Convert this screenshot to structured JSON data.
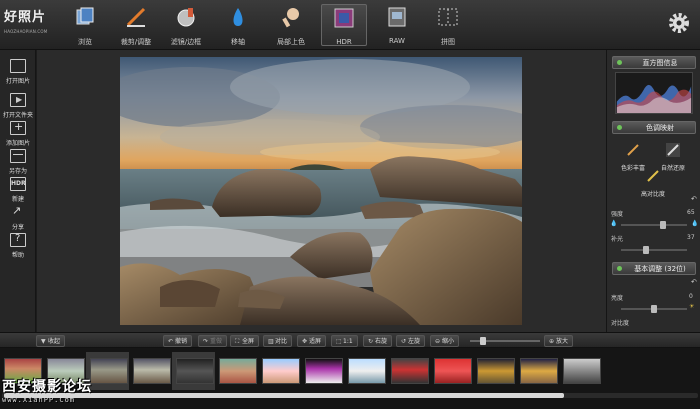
{
  "logo": {
    "title": "好照片",
    "subtitle": "HAOZHAOPIAN.COM"
  },
  "toolbar": [
    {
      "label": "浏览",
      "icon": "browse-icon"
    },
    {
      "label": "裁剪/调整",
      "icon": "crop-adjust-icon"
    },
    {
      "label": "滤镜/边框",
      "icon": "filter-frame-icon"
    },
    {
      "label": "移轴",
      "icon": "tilt-shift-icon"
    },
    {
      "label": "局部上色",
      "icon": "local-color-icon"
    },
    {
      "label": "HDR",
      "icon": "hdr-icon",
      "active": true
    },
    {
      "label": "RAW",
      "icon": "raw-icon"
    },
    {
      "label": "拼图",
      "icon": "collage-icon"
    }
  ],
  "sidebar": [
    {
      "label": "打开图片",
      "icon": "folder-icon"
    },
    {
      "label": "打开文件夹",
      "icon": "open-folder-icon"
    },
    {
      "label": "添加图片",
      "icon": "add-image-icon"
    },
    {
      "label": "另存为",
      "icon": "save-as-icon"
    },
    {
      "label": "新建",
      "icon": "hdr-new-icon",
      "badge": "HDR"
    },
    {
      "label": "分享",
      "icon": "share-icon"
    },
    {
      "label": "帮助",
      "icon": "help-icon",
      "badge": "?"
    }
  ],
  "right_panel": {
    "histogram_title": "直方图信息",
    "tone_map_title": "色调映射",
    "presets": [
      {
        "label": "色彩丰富",
        "icon": "brush-icon"
      },
      {
        "label": "自然还原",
        "icon": "brush-icon"
      },
      {
        "label": "高对比度",
        "icon": "brush-icon"
      }
    ],
    "strength": {
      "label": "强度",
      "value": "65",
      "fraction": 0.65
    },
    "fill_light": {
      "label": "补光",
      "value": "37",
      "fraction": 0.37
    },
    "basic_adjust_title": "基本调整 (32位)",
    "brightness": {
      "label": "亮度",
      "value": "0",
      "fraction": 0.5
    },
    "contrast": {
      "label": "对比度"
    }
  },
  "bottom_toolbar": {
    "collapse": "收起",
    "undo": "撤销",
    "redo": "重做",
    "fullscreen": "全屏",
    "compare": "对比",
    "fit": "适屏",
    "actual": "1:1",
    "rotate_right": "右旋",
    "rotate_left": "左旋",
    "zoom_out": "缩小",
    "zoom_in": "放大"
  },
  "filmstrip": {
    "thumbnails": [
      "thumb-1",
      "thumb-2",
      "thumb-3",
      "thumb-4",
      "thumb-5",
      "thumb-6",
      "thumb-7",
      "thumb-8",
      "thumb-9",
      "thumb-10",
      "thumb-11",
      "thumb-12",
      "thumb-13",
      "thumb-14"
    ],
    "selected_indices": [
      2,
      4
    ]
  },
  "watermark": {
    "title": "西安摄影论坛",
    "url": "www.XianPP.Com"
  },
  "colors": {
    "accent_green": "#6ec45a",
    "toolbar_dark": "#222222",
    "active_border": "#666666"
  }
}
